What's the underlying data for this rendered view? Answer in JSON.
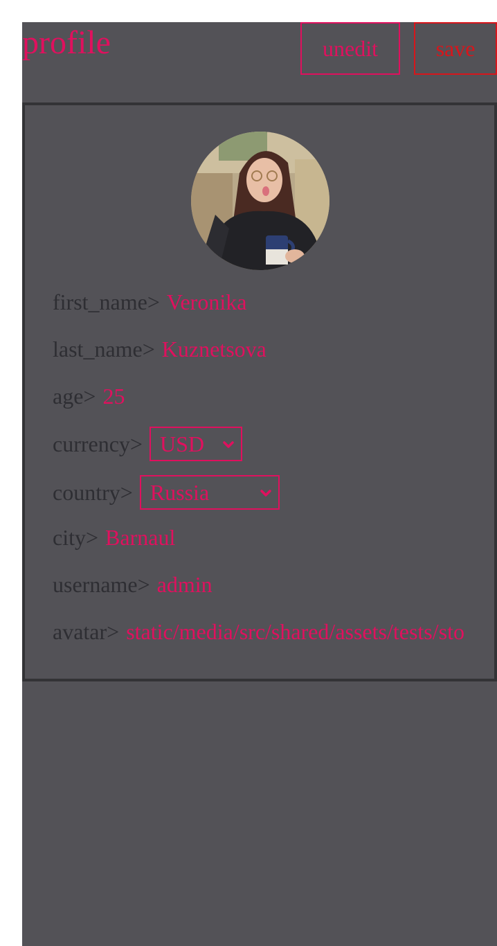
{
  "header": {
    "title": "profile",
    "unedit_label": "unedit",
    "save_label": "save"
  },
  "profile": {
    "fields": {
      "first_name": {
        "label": "first_name",
        "value": "Veronika"
      },
      "last_name": {
        "label": "last_name",
        "value": "Kuznetsova"
      },
      "age": {
        "label": "age",
        "value": "25"
      },
      "currency": {
        "label": "currency",
        "value": "USD"
      },
      "country": {
        "label": "country",
        "value": "Russia"
      },
      "city": {
        "label": "city",
        "value": "Barnaul"
      },
      "username": {
        "label": "username",
        "value": "admin"
      },
      "avatar": {
        "label": "avatar",
        "value": "static/media/src/shared/assets/tests/sto"
      }
    },
    "separator": ">"
  },
  "icons": {
    "avatar": "user-avatar-photo",
    "currency_chevron": "chevron-down-icon",
    "country_chevron": "chevron-down-icon"
  },
  "colors": {
    "accent": "#e0105e",
    "save": "#d8151b",
    "background": "#535257",
    "label_text": "#2e2e33",
    "card_border": "#333336"
  }
}
